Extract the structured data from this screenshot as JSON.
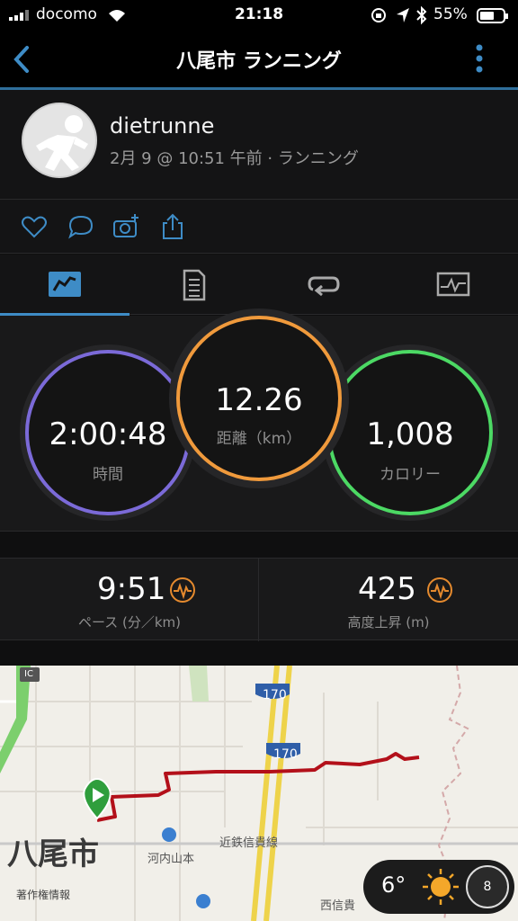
{
  "status": {
    "carrier": "docomo",
    "time": "21:18",
    "battery": "55%"
  },
  "nav": {
    "title": "八尾市 ランニング"
  },
  "profile": {
    "username": "dietrunne",
    "meta": "2月 9 @ 10:51 午前 · ランニング"
  },
  "metrics": {
    "time": {
      "value": "2:00:48",
      "label": "時間",
      "color": "#7b6ad8"
    },
    "distance": {
      "value": "12.26",
      "label": "距離（km）",
      "color": "#f09a3c"
    },
    "calories": {
      "value": "1,008",
      "label": "カロリー",
      "color": "#4cd964"
    }
  },
  "stats": {
    "pace": {
      "value": "9:51",
      "label": "ペース (分／km)"
    },
    "elevation": {
      "value": "425",
      "label": "高度上昇 (m)"
    }
  },
  "map": {
    "city": "八尾市",
    "station": "河内山本",
    "rail_line": "近鉄信貴線",
    "route_170a": "170",
    "route_170b": "170",
    "ic": "IC",
    "lower_label": "西信貴",
    "credit": "著作権情報",
    "weather_temp": "6°",
    "wind": "8"
  },
  "colors": {
    "accent": "#3e8cc6",
    "route": "#b3101a",
    "start": "#2f9e3c"
  }
}
